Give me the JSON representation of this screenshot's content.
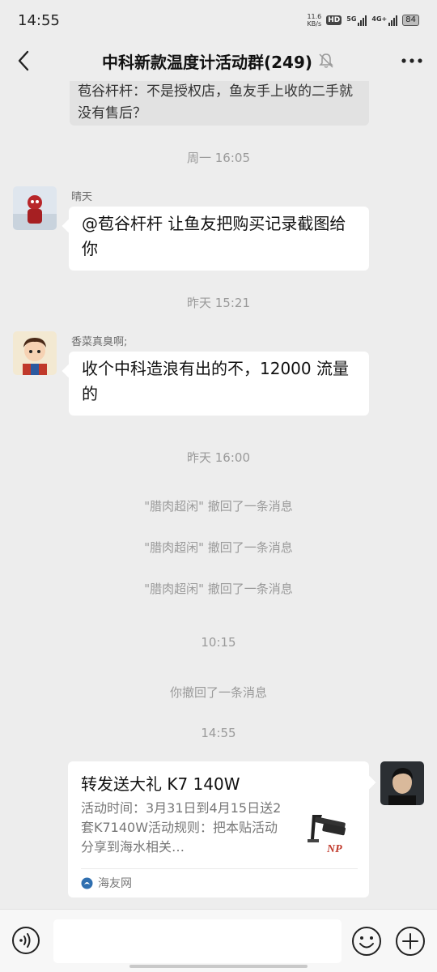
{
  "status_bar": {
    "time": "14:55",
    "net_speed_value": "11.6",
    "net_speed_unit": "KB/s",
    "hd_label": "HD",
    "sim1_label": "5G",
    "sim2_label": "4G+",
    "battery": "84"
  },
  "nav": {
    "title": "中科新款温度计活动群(249)"
  },
  "messages": {
    "quoted_text": "苞谷杆杆：不是授权店，鱼友手上收的二手就没有售后？",
    "ts1": "周一 16:05",
    "msg1_sender": "晴天",
    "msg1_text": "@苞谷杆杆  让鱼友把购买记录截图给你",
    "ts2": "昨天 15:21",
    "msg2_sender": "香菜真臭啊;",
    "msg2_text": "收个中科造浪有出的不，12000 流量的",
    "ts3": "昨天 16:00",
    "recall1": "\"腊肉超闲\" 撤回了一条消息",
    "recall2": "\"腊肉超闲\" 撤回了一条消息",
    "recall3": "\"腊肉超闲\" 撤回了一条消息",
    "ts4": "10:15",
    "recall_self": "你撤回了一条消息",
    "ts5": "14:55",
    "card_title": "转发送大礼 K7 140W",
    "card_desc": "活动时间：3月31日到4月15日送2套K7140W活动规则：把本贴活动分享到海水相关…",
    "card_source": "海友网",
    "card_thumb_brand": "NP"
  },
  "icons": {
    "back": "back-chevron-icon",
    "mute": "mute-bell-icon",
    "more": "more-dots-icon",
    "voice": "voice-icon",
    "emoji": "emoji-icon",
    "plus": "plus-icon",
    "source": "haiyou-logo-icon"
  },
  "colors": {
    "background": "#ededed",
    "bubble": "#ffffff",
    "system_text": "#9a9a9a",
    "brand_red": "#c0392b"
  }
}
